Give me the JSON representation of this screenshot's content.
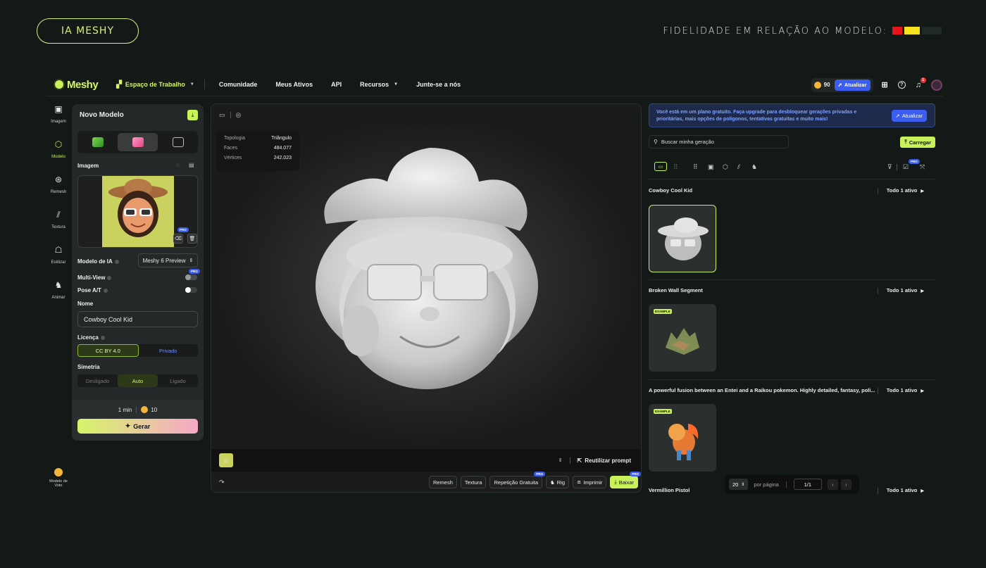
{
  "presentation": {
    "pill_label": "IA MESHY",
    "fidelity_label": "FIDELIDADE EM RELAÇÃO AO MODELO:",
    "fidelity_colors": [
      "#e8141c",
      "#f7e21b",
      "#1f2a24"
    ]
  },
  "nav": {
    "brand": "Meshy",
    "workspace": "Espaço de Trabalho",
    "items": [
      "Comunidade",
      "Meus Ativos",
      "API",
      "Recursos",
      "Junte-se a nós"
    ],
    "credits": "90",
    "upgrade": "Atualizar",
    "notif_count": "1"
  },
  "rail": [
    {
      "label": "Imagem",
      "icon": "image-icon"
    },
    {
      "label": "Modelo",
      "icon": "cube-icon"
    },
    {
      "label": "Remesh",
      "icon": "remesh-icon"
    },
    {
      "label": "Textura",
      "icon": "texture-icon"
    },
    {
      "label": "Estilizar",
      "icon": "stylize-icon"
    },
    {
      "label": "Animar",
      "icon": "run-icon"
    }
  ],
  "rail_bottom": {
    "line1": "Modelo de",
    "line2": "Voto"
  },
  "panel": {
    "title": "Novo Modelo",
    "image_label": "Imagem",
    "ai_model_label": "Modelo de IA",
    "ai_model_value": "Meshy 6 Preview",
    "multiview_label": "Multi-View",
    "pose_label": "Pose A/T",
    "name_label": "Nome",
    "name_value": "Cowboy Cool Kid",
    "license_label": "Licença",
    "license_options": [
      "CC BY 4.0",
      "Privado"
    ],
    "symmetry_label": "Simetria",
    "symmetry_options": [
      "Desligado",
      "Auto",
      "Ligado"
    ],
    "time": "1 min",
    "cost": "10",
    "generate": "Gerar",
    "pro": "PRO"
  },
  "viewport": {
    "stats": [
      {
        "k": "Topologia",
        "v": "Triângulo"
      },
      {
        "k": "Faces",
        "v": "484.077"
      },
      {
        "k": "Vértices",
        "v": "242.023"
      }
    ],
    "reuse_prompt": "Reutilizar prompt",
    "actions": [
      "Remesh",
      "Textura",
      "Repetição Gratuita",
      "Rig",
      "Imprimir"
    ],
    "download": "Baixar"
  },
  "right": {
    "banner": "Você está em um plano gratuito. Faça upgrade para desbloquear gerações privadas e prioritárias, mais opções de polígonos, tentativas gratuitas e muito mais!",
    "banner_btn": "Atualizar",
    "search_placeholder": "Buscar minha geração",
    "upload": "Carregar",
    "sections": [
      {
        "title": "Cowboy Cool Kid",
        "count": "Todo 1 ativo"
      },
      {
        "title": "Broken Wall Segment",
        "count": "Todo 1 ativo"
      },
      {
        "title": "A powerful fusion between an Entei and a Raikou pokemon. Highly detailed, fantasy, poli...",
        "count": "Todo 1 ativo"
      },
      {
        "title": "Vermillion Pistol",
        "count": "Todo 1 ativo"
      }
    ],
    "example_tag": "EXAMPLE",
    "pager": {
      "per_page": "20",
      "per_page_label": "por página",
      "page": "1/1"
    }
  }
}
